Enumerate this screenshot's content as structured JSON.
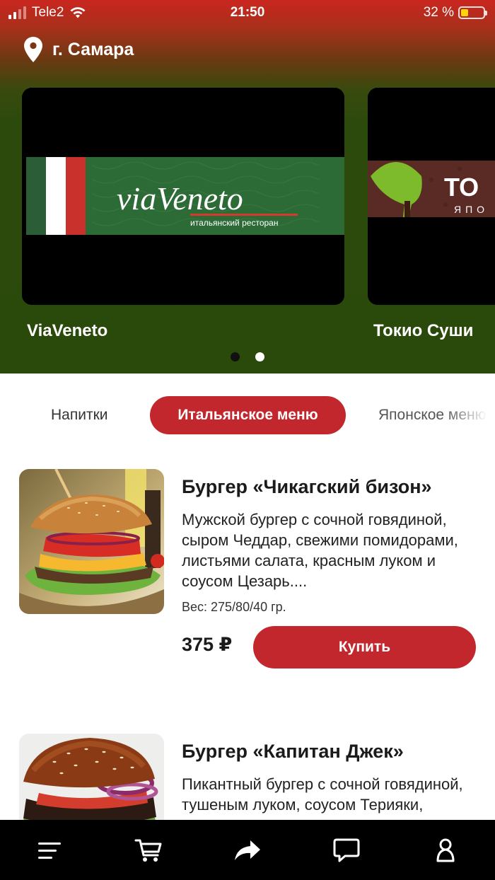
{
  "status_bar": {
    "carrier": "Tele2",
    "time": "21:50",
    "battery_text": "32 %",
    "battery_level": 0.32
  },
  "location": {
    "city": "г. Самара",
    "icon": "map-pin-icon"
  },
  "restaurants": [
    {
      "name": "ViaVeneto",
      "logo_text": "viaVeneto",
      "logo_sub": "итальянский ресторан"
    },
    {
      "name": "Токио Суши",
      "logo_text": "ТО",
      "logo_sub": "ЯПО"
    }
  ],
  "carousel": {
    "active_index": 1,
    "count": 2
  },
  "categories": [
    {
      "label": "Напитки",
      "active": false
    },
    {
      "label": "Итальянское меню",
      "active": true
    },
    {
      "label": "Японское меню",
      "active": false
    }
  ],
  "products": [
    {
      "title": "Бургер «Чикагский бизон»",
      "description": "Мужской бургер с сочной говядиной, сыром Чеддар, свежими помидорами, листьями салата, красным луком и соусом Цезарь....",
      "weight": "Вес: 275/80/40 гр.",
      "price": "375 ₽",
      "buy_label": "Купить"
    },
    {
      "title": "Бургер «Капитан Джек»",
      "description": "Пикантный бургер с сочной говядиной, тушеным луком, соусом Терияки, хрустящими листьями",
      "weight": "",
      "price": "",
      "buy_label": ""
    }
  ],
  "bottom_nav": [
    {
      "name": "menu",
      "icon": "hamburger-menu-icon"
    },
    {
      "name": "cart",
      "icon": "cart-icon"
    },
    {
      "name": "share",
      "icon": "share-arrow-icon"
    },
    {
      "name": "chat",
      "icon": "chat-bubble-icon"
    },
    {
      "name": "profile",
      "icon": "profile-icon"
    }
  ],
  "colors": {
    "accent": "#c2272d",
    "header_top": "#c9261f",
    "header_bottom": "#2a4a0b",
    "nav_bg": "#000000"
  }
}
